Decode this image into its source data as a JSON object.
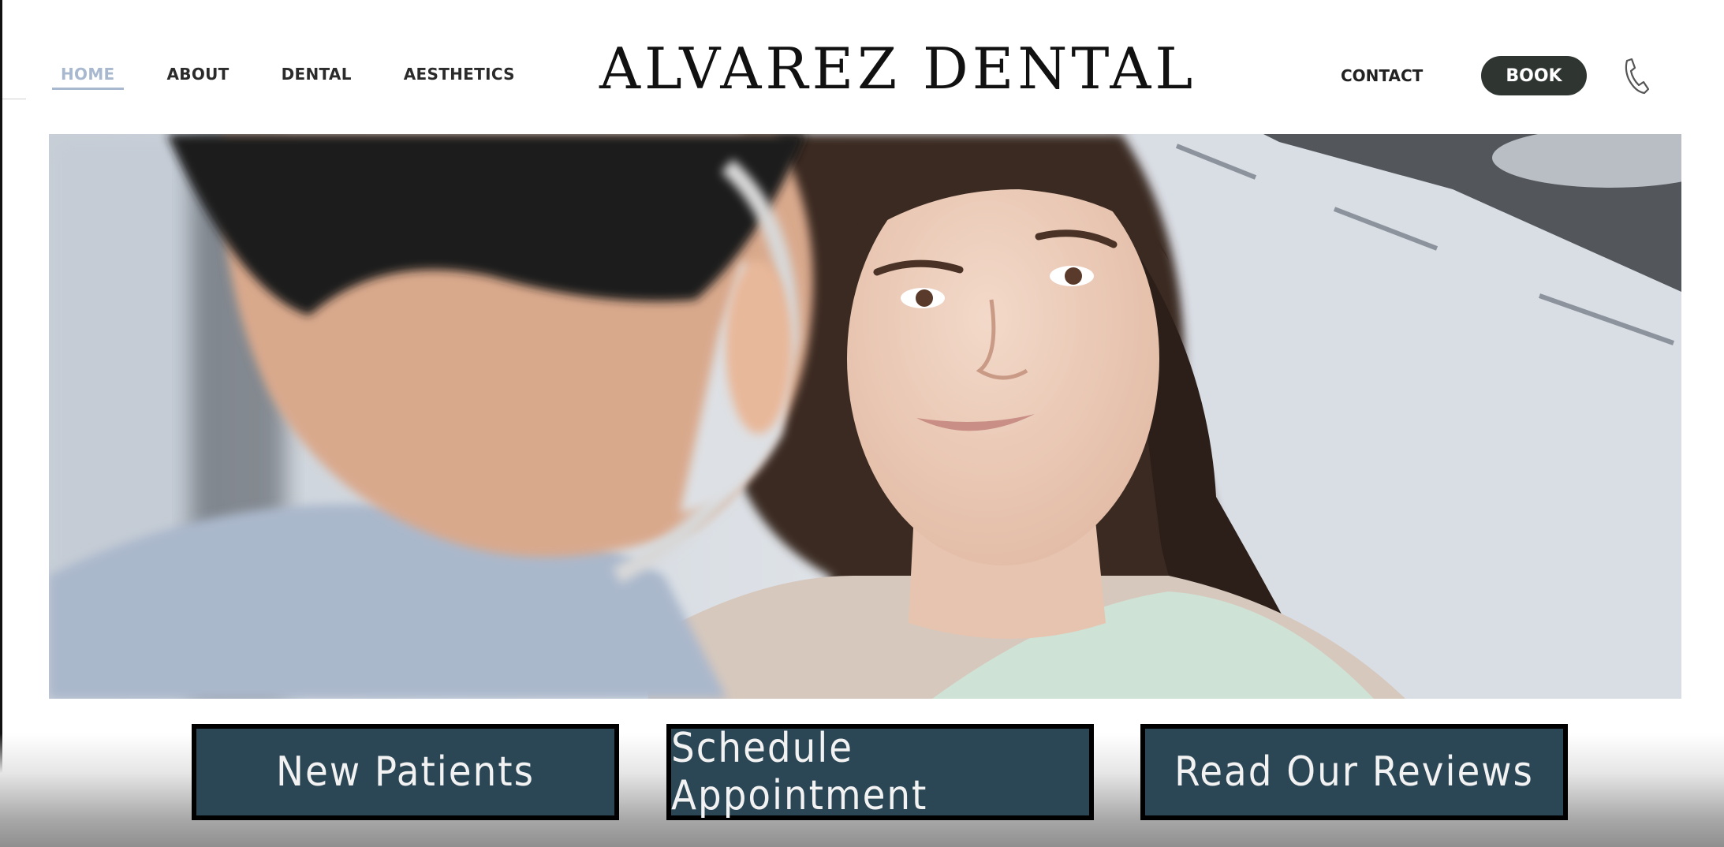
{
  "nav": {
    "items": [
      {
        "label": "HOME",
        "active": true
      },
      {
        "label": "ABOUT",
        "active": false
      },
      {
        "label": "DENTAL",
        "active": false
      },
      {
        "label": "AESTHETICS",
        "active": false
      }
    ],
    "contact_label": "CONTACT",
    "book_label": "BOOK",
    "phone_icon": "phone-icon"
  },
  "brand": {
    "logo_text": "ALVAREZ DENTAL"
  },
  "hero": {
    "image": "photo: smiling patient with curly hair looking at a masked dentist"
  },
  "cta": [
    {
      "label": "New Patients"
    },
    {
      "label": "Schedule Appointment"
    },
    {
      "label": "Read Our Reviews"
    }
  ],
  "colors": {
    "nav_active": "#a8b9cf",
    "book_button": "#2f3531",
    "cta_background": "#2b4756",
    "cta_border": "#000000"
  }
}
